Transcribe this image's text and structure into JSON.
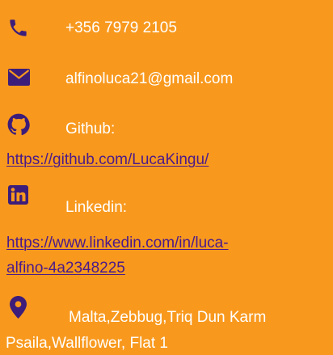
{
  "contact": {
    "phone": {
      "icon": "phone-icon",
      "text": "+356 7979 2105"
    },
    "email": {
      "icon": "envelope-icon",
      "text": "alfinoluca21@gmail.com"
    },
    "github": {
      "icon": "github-icon",
      "label": "Github:",
      "url": "https://github.com/LucaKingu/"
    },
    "linkedin": {
      "icon": "linkedin-icon",
      "label": "Linkedin:",
      "url_line1": "https://www.linkedin.com/in/luca-",
      "url_line2": "alfino-4a2348225"
    },
    "address": {
      "icon": "map-pin-icon",
      "line1": "Malta,Zebbug,Triq Dun Karm",
      "line2": "Psaila,Wallflower, Flat 1"
    }
  },
  "colors": {
    "background": "#f8991e",
    "icon": "#3d1d7a",
    "text": "#ffffff",
    "link": "#4b1a8a"
  }
}
